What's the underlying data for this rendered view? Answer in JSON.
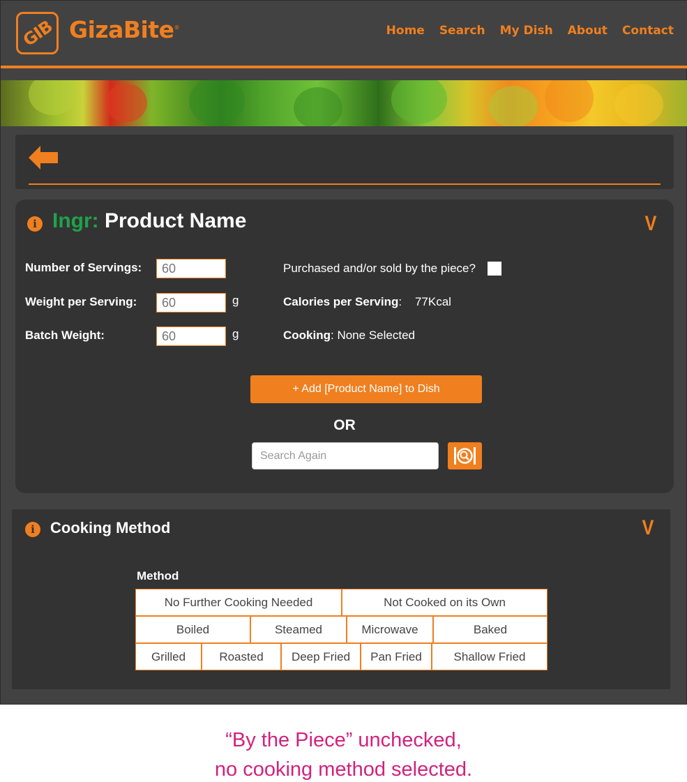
{
  "brand": {
    "logo_mark": "GIB",
    "name": "GizaBite",
    "trademark": "®"
  },
  "nav": {
    "items": [
      "Home",
      "Search",
      "My Dish",
      "About",
      "Contact"
    ]
  },
  "icons": {
    "back": "back-arrow-icon",
    "info": "info-icon",
    "collapse": "chevron-down-icon",
    "search": "plate-search-icon"
  },
  "colors": {
    "accent": "#f07f1f",
    "ingr_prefix": "#1fa24a",
    "panel": "#333333",
    "background": "#424242",
    "caption": "#d1227e"
  },
  "ingredient": {
    "prefix": "Ingr:",
    "name": "Product Name",
    "info_glyph": "i",
    "collapse_glyph": "V",
    "servings_label": "Number of Servings:",
    "servings_value": "60",
    "weight_label": "Weight per Serving:",
    "weight_value": "60",
    "weight_unit": "g",
    "batch_label": "Batch Weight:",
    "batch_value": "60",
    "batch_unit": "g",
    "by_piece_label": "Purchased and/or sold by the piece?",
    "by_piece_checked": false,
    "calories_label": "Calories per Serving",
    "calories_value": "77Kcal",
    "cooking_label": "Cooking",
    "cooking_value": "None Selected",
    "add_button": "+ Add [Product Name] to Dish",
    "or_text": "OR",
    "search_placeholder": "Search Again"
  },
  "cooking": {
    "title": "Cooking Method",
    "info_glyph": "i",
    "collapse_glyph": "V",
    "method_label": "Method",
    "rows": [
      [
        "No Further Cooking Needed",
        "Not Cooked on its Own"
      ],
      [
        "Boiled",
        "Steamed",
        "Microwave",
        "Baked"
      ],
      [
        "Grilled",
        "Roasted",
        "Deep Fried",
        "Pan Fried",
        "Shallow Fried"
      ]
    ],
    "selected": null
  },
  "caption": {
    "line1": "“By the Piece”  unchecked,",
    "line2": "no cooking method selected."
  }
}
